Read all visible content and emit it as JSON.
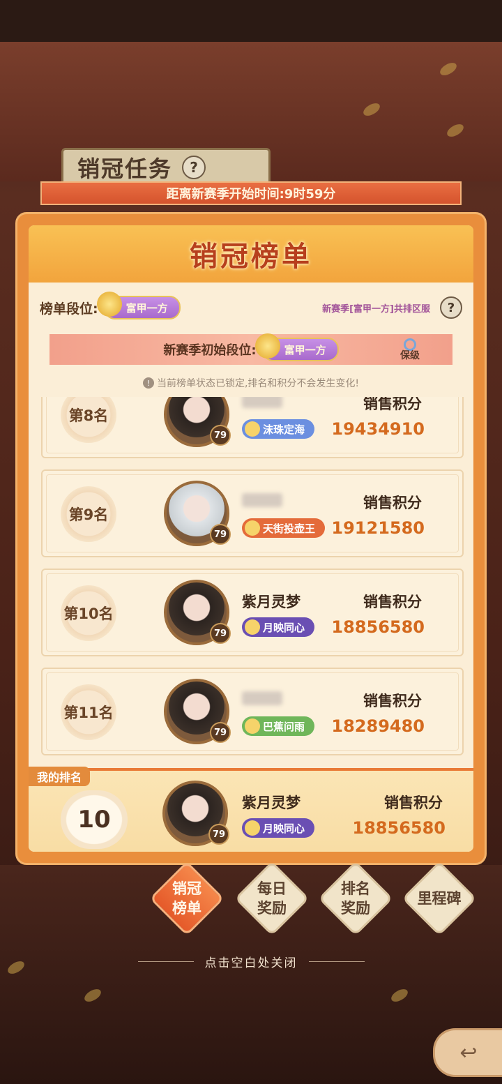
{
  "task_title": "销冠任务",
  "season_banner": "距离新赛季开始时间:9时59分",
  "board": {
    "title": "销冠榜单",
    "tier_label": "榜单段位:",
    "tier_name": "富甲一方",
    "tier_note": "新赛季[富甲一方]共排区服",
    "init_label": "新赛季初始段位:",
    "init_tier": "富甲一方",
    "keep_label": "保级",
    "lock_notice": "当前榜单状态已锁定,排名和积分不会发生变化!",
    "help_icon": "?"
  },
  "score_label": "销售积分",
  "ranks": [
    {
      "rank": "第8名",
      "name": "",
      "level": "79",
      "title": "沫珠定海",
      "title_color": "#6b8fe0",
      "score": "19434910"
    },
    {
      "rank": "第9名",
      "name": "",
      "level": "79",
      "title": "天街投壶王",
      "title_color": "#e46b3a",
      "score": "19121580"
    },
    {
      "rank": "第10名",
      "name": "紫月灵梦",
      "level": "79",
      "title": "月映同心",
      "title_color": "#6a4fb3",
      "score": "18856580"
    },
    {
      "rank": "第11名",
      "name": "",
      "level": "79",
      "title": "巴蕉问雨",
      "title_color": "#6fb65a",
      "score": "18289480"
    }
  ],
  "my_rank": {
    "tag": "我的排名",
    "rank": "10",
    "name": "紫月灵梦",
    "level": "79",
    "title": "月映同心",
    "title_color": "#6a4fb3",
    "score": "18856580"
  },
  "tabs": [
    {
      "label": "销冠\n榜单",
      "active": true
    },
    {
      "label": "每日\n奖励",
      "active": false
    },
    {
      "label": "排名\n奖励",
      "active": false
    },
    {
      "label": "里程碑",
      "active": false
    }
  ],
  "close_hint": "点击空白处关闭",
  "icons": {
    "help": "question-icon",
    "lock": "info-icon",
    "back": "back-arrow-icon"
  }
}
